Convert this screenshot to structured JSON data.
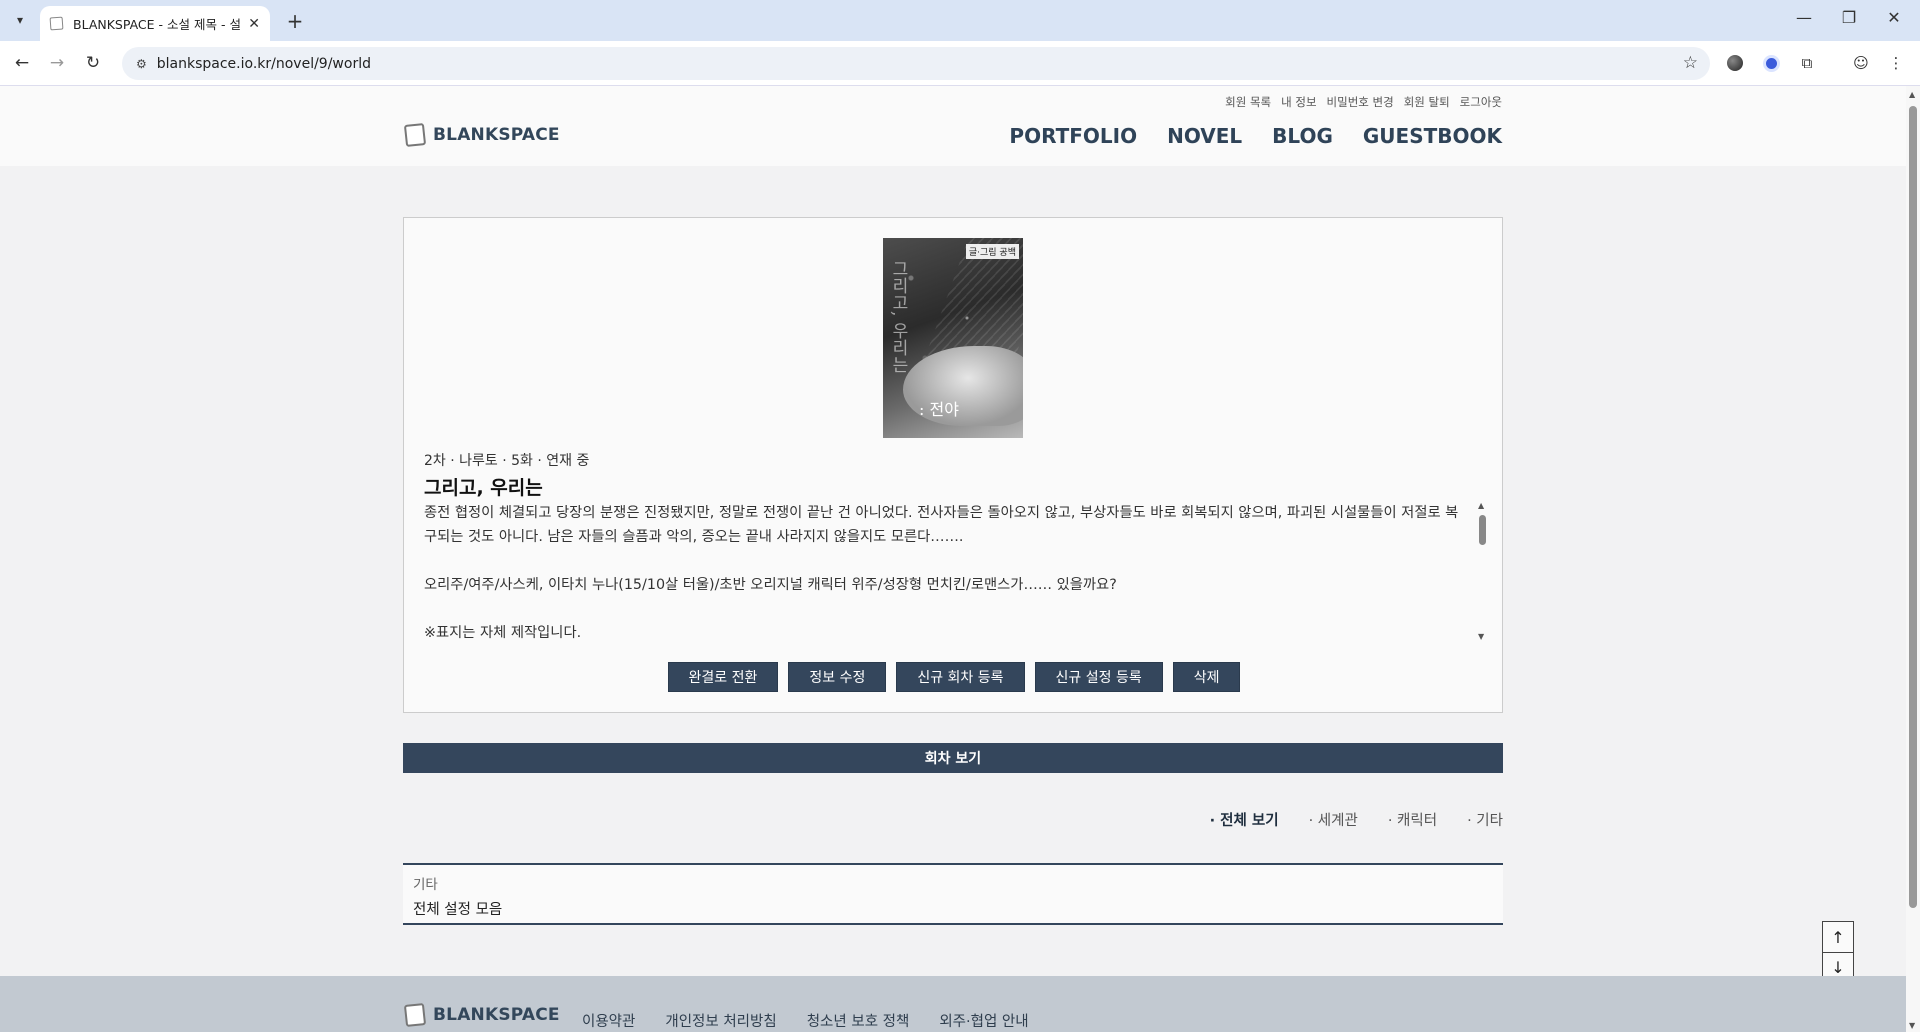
{
  "browser": {
    "tab_title": "BLANKSPACE - 소설 제목 - 설",
    "url": "blankspace.io.kr/novel/9/world"
  },
  "header": {
    "util_links": [
      "회원 목록",
      "내 정보",
      "비밀번호 변경",
      "회원 탈퇴",
      "로그아웃"
    ],
    "logo_text": "BLANKSPACE",
    "nav": [
      "PORTFOLIO",
      "NOVEL",
      "BLOG",
      "GUESTBOOK"
    ]
  },
  "novel": {
    "cover": {
      "vertical_title": "그리고, 우리는",
      "subtitle": ": 전야",
      "badge": "글·그림 공백"
    },
    "meta": "2차 · 나루토 · 5화 · 연재 중",
    "title": "그리고, 우리는",
    "description": "종전 협정이 체결되고 당장의 분쟁은 진정됐지만, 정말로 전쟁이 끝난 건 아니었다. 전사자들은 돌아오지 않고, 부상자들도 바로 회복되지 않으며, 파괴된 시설물들이 저절로 복구되는 것도 아니다. 남은 자들의 슬픔과 악의, 증오는 끝내 사라지지 않을지도 모른다…….\n\n오리주/여주/사스케, 이타치 누나(15/10살 터울)/초반 오리지널 캐릭터 위주/성장형 먼치킨/로맨스가…… 있을까요?\n\n※표지는 자체 제작입니다.",
    "buttons": {
      "complete": "완결로 전환",
      "edit": "정보 수정",
      "new_episode": "신규 회차 등록",
      "new_setting": "신규 설정 등록",
      "delete": "삭제"
    }
  },
  "episodes": {
    "bar_label": "회차 보기",
    "filters": [
      "· 전체 보기",
      "· 세계관",
      "· 캐릭터",
      "· 기타"
    ],
    "active_filter": "· 전체 보기",
    "settings": [
      {
        "category": "기타",
        "name": "전체 설정 모음"
      }
    ]
  },
  "float_buttons": {
    "up_icon": "arrow-up-icon",
    "down_icon": "arrow-down-icon"
  },
  "footer": {
    "logo_text": "BLANKSPACE",
    "links": [
      "이용약관",
      "개인정보 처리방침",
      "청소년 보호 정책",
      "외주·협업 안내"
    ]
  },
  "colors": {
    "accent": "#34465c",
    "footer_bg": "#c2c9d1",
    "tabbar_bg": "#d9e4f5"
  }
}
